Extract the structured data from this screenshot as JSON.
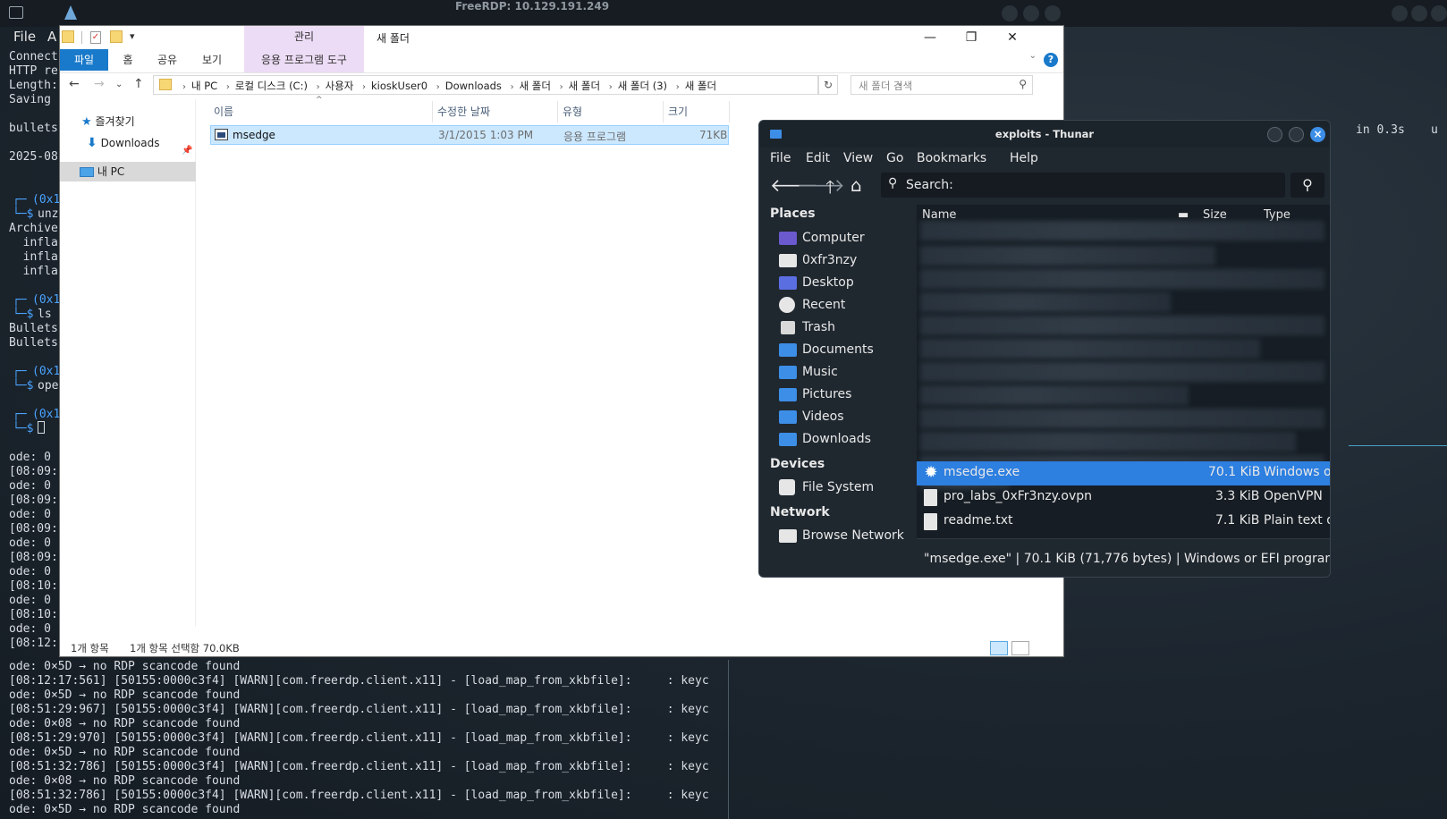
{
  "rdp": {
    "title": "FreeRDP: 10.129.191.249"
  },
  "terminal": {
    "menu_file": "File",
    "menu_a": "A",
    "left_lines": [
      "Connect",
      "HTTP re",
      "Length:",
      "Saving",
      "bullets",
      "2025-08"
    ],
    "prompt_hex": "(0x1",
    "prompt_lines": [
      "unz",
      "Archive",
      "  infla",
      "  infla",
      "  infla",
      "ls",
      "Bullets",
      "Bullets",
      "ope"
    ],
    "log_short": [
      "ode: 0",
      "[08:09:",
      "ode: 0",
      "[08:09:",
      "ode: 0",
      "[08:09:",
      "ode: 0",
      "[08:09:",
      "ode: 0",
      "[08:10:",
      "ode: 0",
      "[08:10:",
      "ode: 0",
      "[08:12:"
    ],
    "log_lines": [
      "ode: 0×5D → no RDP scancode found",
      "[08:12:17:561] [50155:0000c3f4] [WARN][com.freerdp.client.x11] - [load_map_from_xkbfile]:     : keyc",
      "ode: 0×5D → no RDP scancode found",
      "[08:51:29:967] [50155:0000c3f4] [WARN][com.freerdp.client.x11] - [load_map_from_xkbfile]:     : keyc",
      "ode: 0×08 → no RDP scancode found",
      "[08:51:29:970] [50155:0000c3f4] [WARN][com.freerdp.client.x11] - [load_map_from_xkbfile]:     : keyc",
      "ode: 0×5D → no RDP scancode found",
      "[08:51:32:786] [50155:0000c3f4] [WARN][com.freerdp.client.x11] - [load_map_from_xkbfile]:     : keyc",
      "ode: 0×08 → no RDP scancode found",
      "[08:51:32:786] [50155:0000c3f4] [WARN][com.freerdp.client.x11] - [load_map_from_xkbfile]:     : keyc",
      "ode: 0×5D → no RDP scancode found"
    ],
    "right_text": "in 0.3s",
    "right_u": "u"
  },
  "explorer": {
    "title": "새 폴더",
    "context_group": "관리",
    "tabs": [
      "파일",
      "홈",
      "공유",
      "보기",
      "응용 프로그램 도구"
    ],
    "help": "?",
    "breadcrumbs": [
      "내 PC",
      "로컬 디스크 (C:)",
      "사용자",
      "kioskUser0",
      "Downloads",
      "새 폴더",
      "새 폴더",
      "새 폴더 (3)",
      "새 폴더"
    ],
    "search_placeholder": "새 폴더 검색",
    "nav": {
      "favorites": "즐겨찾기",
      "downloads": "Downloads",
      "this_pc": "내 PC"
    },
    "columns": {
      "name": "이름",
      "modified": "수정한 날짜",
      "type": "유형",
      "size": "크기"
    },
    "files": [
      {
        "name": "msedge",
        "modified": "3/1/2015 1:03 PM",
        "type": "응용 프로그램",
        "size": "71KB"
      }
    ],
    "status": {
      "count": "1개 항목",
      "selected": "1개 항목 선택함 70.0KB"
    }
  },
  "thunar": {
    "title": "exploits - Thunar",
    "menu": [
      "File",
      "Edit",
      "View",
      "Go",
      "Bookmarks",
      "Help"
    ],
    "search_label": "Search:",
    "sections": {
      "places": "Places",
      "devices": "Devices",
      "network": "Network"
    },
    "places": [
      "Computer",
      "0xfr3nzy",
      "Desktop",
      "Recent",
      "Trash",
      "Documents",
      "Music",
      "Pictures",
      "Videos",
      "Downloads"
    ],
    "devices": [
      "File System"
    ],
    "network": [
      "Browse Network"
    ],
    "columns": {
      "name": "Name",
      "size": "Size",
      "type": "Type"
    },
    "files": [
      {
        "name": "msedge.exe",
        "size": "70.1 KiB",
        "type": "Windows or EFI program"
      },
      {
        "name": "pro_labs_0xFr3nzy.ovpn",
        "size": "3.3 KiB",
        "type": "OpenVPN"
      },
      {
        "name": "readme.txt",
        "size": "7.1 KiB",
        "type": "Plain text document"
      }
    ],
    "status": "\"msedge.exe\" | 70.1 KiB (71,776 bytes) | Windows or EFI program"
  },
  "colors": {
    "thunar_accent": "#2d7fe0",
    "explorer_accent": "#1979ca",
    "selection_bg": "#cce8ff"
  },
  "icons": [
    "folder-icon",
    "computer-icon",
    "trash-icon",
    "home-icon",
    "search-icon",
    "gear-icon",
    "text-file-icon"
  ]
}
